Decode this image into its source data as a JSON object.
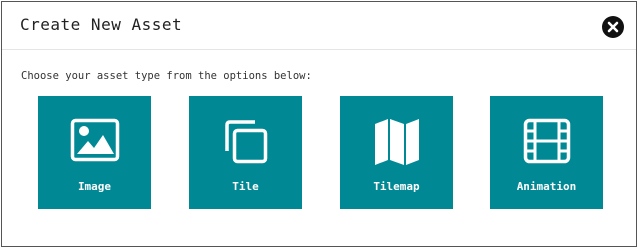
{
  "dialog": {
    "title": "Create New Asset",
    "close_icon": "close-circle-icon",
    "prompt": "Choose your asset type from the options below:"
  },
  "asset_types": [
    {
      "label": "Image",
      "icon": "image-icon"
    },
    {
      "label": "Tile",
      "icon": "tile-icon"
    },
    {
      "label": "Tilemap",
      "icon": "map-icon"
    },
    {
      "label": "Animation",
      "icon": "film-icon"
    }
  ],
  "colors": {
    "tile_background": "#008995",
    "tile_text": "#ffffff",
    "close_button": "#111111"
  }
}
